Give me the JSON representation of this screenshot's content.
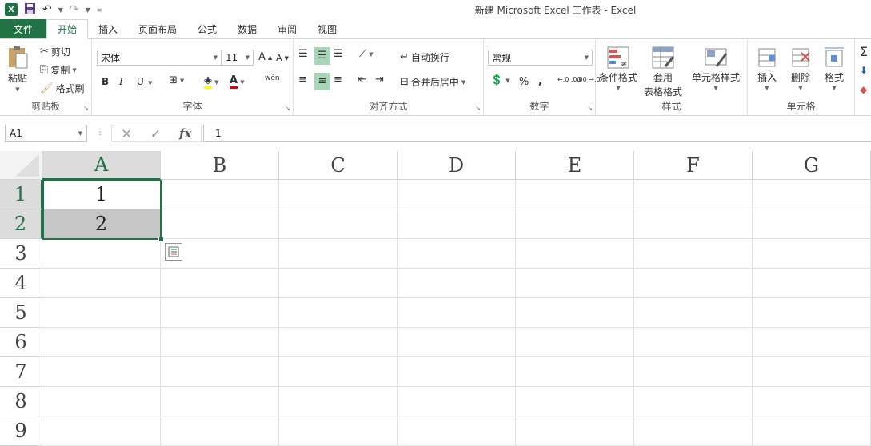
{
  "window": {
    "title": "新建 Microsoft Excel 工作表 - Excel",
    "logo": "X"
  },
  "qat": {
    "save_icon": "save-icon",
    "undo_icon": "undo-icon",
    "redo_icon": "redo-icon"
  },
  "tabs": [
    {
      "label": "文件"
    },
    {
      "label": "开始"
    },
    {
      "label": "插入"
    },
    {
      "label": "页面布局"
    },
    {
      "label": "公式"
    },
    {
      "label": "数据"
    },
    {
      "label": "审阅"
    },
    {
      "label": "视图"
    }
  ],
  "ribbon": {
    "clipboard": {
      "label": "剪贴板",
      "paste": "粘贴",
      "cut": "剪切",
      "copy": "复制",
      "format_painter": "格式刷"
    },
    "font": {
      "label": "字体",
      "font_name": "宋体",
      "font_size": "11",
      "bold": "B",
      "italic": "I",
      "underline": "U",
      "grow": "A",
      "shrink": "A",
      "phonetic": "wén"
    },
    "alignment": {
      "label": "对齐方式",
      "wrap": "自动换行",
      "merge": "合并后居中"
    },
    "number": {
      "label": "数字",
      "format": "常规",
      "percent": "%",
      "comma": ",",
      "inc_decimal": "←.0 .00",
      "dec_decimal": ".00 →.0"
    },
    "styles": {
      "label": "样式",
      "conditional": "条件格式",
      "table_format_1": "套用",
      "table_format_2": "表格格式",
      "cell_styles": "单元格样式"
    },
    "cells": {
      "label": "单元格",
      "insert": "插入",
      "delete": "删除",
      "format": "格式"
    }
  },
  "formula_bar": {
    "name_box": "A1",
    "cancel": "✕",
    "enter": "✓",
    "fx": "fx",
    "value": "1"
  },
  "sheet": {
    "columns": [
      "A",
      "B",
      "C",
      "D",
      "E",
      "F",
      "G"
    ],
    "rows": [
      "1",
      "2",
      "3",
      "4",
      "5",
      "6",
      "7",
      "8",
      "9"
    ],
    "cells": {
      "A1": "1",
      "A2": "2"
    },
    "selection": "A1:A2",
    "active_color": "#217346"
  }
}
